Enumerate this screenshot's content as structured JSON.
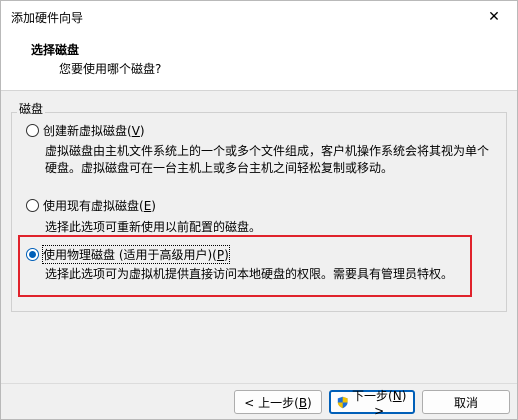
{
  "window": {
    "title": "添加硬件向导",
    "close_glyph": "✕"
  },
  "header": {
    "title": "选择磁盘",
    "subtitle": "您要使用哪个磁盘?"
  },
  "group": {
    "label": "磁盘"
  },
  "options": [
    {
      "label": "创建新虚拟磁盘(",
      "mnemonic": "V",
      "label_end": ")",
      "desc_lines": [
        "虚拟磁盘由主机文件系统上的一个或多个文件组成，客户机操作系统会将其视为单个",
        "硬盘。虚拟磁盘可在一台主机上或多台主机之间轻松复制或移动。"
      ],
      "checked": false
    },
    {
      "label": "使用现有虚拟磁盘(",
      "mnemonic": "E",
      "label_end": ")",
      "desc_lines": [
        "选择此选项可重新使用以前配置的磁盘。"
      ],
      "checked": false
    },
    {
      "label": "使用物理磁盘 (适用于高级用户)(",
      "mnemonic": "P",
      "label_end": ")",
      "desc_lines": [
        "选择此选项可为虚拟机提供直接访问本地硬盘的权限。需要具有管理员特权。"
      ],
      "checked": true
    }
  ],
  "buttons": {
    "back_label": "< 上一步(",
    "back_mnemonic": "B",
    "back_end": ")",
    "next_label": "下一步(",
    "next_mnemonic": "N",
    "next_end": ") >",
    "cancel_label": "取消"
  },
  "colors": {
    "accent": "#005fb8",
    "highlight": "#e0222b"
  }
}
